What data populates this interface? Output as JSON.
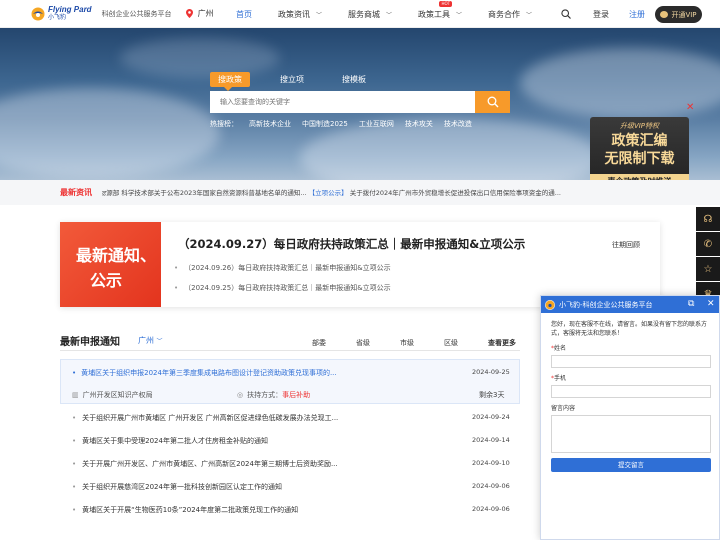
{
  "header": {
    "logo_en": "Flying Pard",
    "logo_cn": "小飞豹",
    "slogan": "科创企业公共服务平台",
    "city": "广州",
    "nav": [
      {
        "label": "首页",
        "dropdown": false
      },
      {
        "label": "政策资讯",
        "dropdown": true
      },
      {
        "label": "服务商城",
        "dropdown": true
      },
      {
        "label": "政策工具",
        "dropdown": true,
        "badge": "HOT"
      },
      {
        "label": "商务合作",
        "dropdown": true
      }
    ],
    "login": "登录",
    "register": "注册",
    "vip": "开通VIP"
  },
  "banner": {
    "tabs": [
      "搜政策",
      "搜立项",
      "搜模板"
    ],
    "search_placeholder": "输入您要查询的关键字",
    "hot_label": "热搜榜：",
    "hot_words": [
      "高新技术企业",
      "中国制造2025",
      "工业互联网",
      "技术攻关",
      "技术改造"
    ]
  },
  "promo": {
    "line1": "升级VIP特权",
    "line2": "政策汇编",
    "line3": "无限制下载",
    "line4": "惠企政策及时推送"
  },
  "ticker": {
    "label": "最新资讯",
    "text_a": "ਫ਼源部 科学技术部关于公布2023年国家自然资源科普基地名单的通知...",
    "text_b": "【立项公示】",
    "text_c": "关于拨付2024年广州市外贸稳增长促进投保出口信用保险事项资金的通..."
  },
  "feature": {
    "image_line1": "最新通知、",
    "image_line2": "公示",
    "title": "（2024.09.27）每日政府扶持政策汇总｜最新申报通知&立项公示",
    "past": "往期回顾",
    "subs": [
      "（2024.09.26）每日政府扶持政策汇总｜最新申报通知&立项公示",
      "（2024.09.25）每日政府扶持政策汇总｜最新申报通知&立项公示"
    ]
  },
  "latest": {
    "title": "最新申报通知",
    "city": "广州",
    "tabs": [
      "部委",
      "省级",
      "市级",
      "区级"
    ],
    "more": "查看更多",
    "highlight": {
      "title": "黄埔区关于组织申报2024年第三季度集成电路布图设计登记资助政策兑现事项的...",
      "date": "2024-09-25",
      "org": "广州开发区知识产权局",
      "mode_label": "扶持方式：",
      "mode_value": "事后补助",
      "left": "剩余3天"
    },
    "items": [
      {
        "title": "关于组织开展广州市黄埔区 广州开发区 广州高新区促进绿色低碳发展办法兑现工...",
        "date": "2024-09-24"
      },
      {
        "title": "黄埔区关于集中受理2024年第二批人才住房租金补贴的通知",
        "date": "2024-09-14"
      },
      {
        "title": "关于开展广州开发区、广州市黄埔区、广州高新区2024年第三期博士后资助奖励...",
        "date": "2024-09-10"
      },
      {
        "title": "关于组织开展慈湾区2024年第一批科技创新园区认定工作的通知",
        "date": "2024-09-06"
      },
      {
        "title": "黄埔区关于开展“生物医药10条”2024年度第二批政策兑现工作的通知",
        "date": "2024-09-06"
      }
    ]
  },
  "chat": {
    "title": "小飞豹-科创企业公共服务平台",
    "message": "您好，现在客服不在线，请留言。如果没有留下您的联系方式，客服将无法和您联系！",
    "name_label": "姓名",
    "phone_label": "手机",
    "msg_label": "留言内容",
    "submit": "提交留言"
  },
  "colors": {
    "accent": "#2f6fd6",
    "orange": "#f79a2a",
    "red": "#e33333",
    "dark": "#1a1a1a",
    "gold": "#f0c884"
  }
}
